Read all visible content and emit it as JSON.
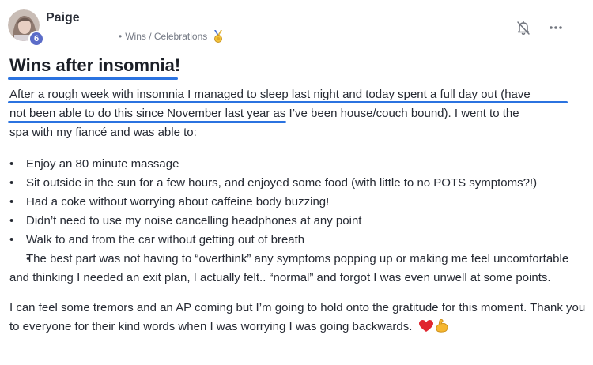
{
  "author": {
    "name": "Paige",
    "level": "6"
  },
  "meta": {
    "separator": "•",
    "category": "Wins / Celebrations"
  },
  "post": {
    "title": "Wins after insomnia!",
    "intro_line1": "After a rough week with insomnia I managed to sleep last night and today spent a full day out (have",
    "intro_line2_highlighted": "not been able to do this since November last year",
    "intro_line2_rest": " as I’ve been house/couch bound). I went to the",
    "intro_line3": "spa with my fiancé and was able to:",
    "bullets": [
      "Enjoy an 80 minute massage",
      "Sit outside in the sun for a few hours, and enjoyed some food (with little to no POTS symptoms?!)",
      "Had a coke without worrying about caffeine body buzzing!",
      "Didn’t need to use my noise cancelling headphones at any point",
      "Walk to and from the car without getting out of breath",
      "The best part was not having to “overthink” any symptoms popping up or making me feel uncomfortable and thinking I needed an exit plan, I actually felt.. “normal” and forgot I was even unwell at some points."
    ],
    "closing": "I can feel some tremors and an AP coming but I’m going to hold onto the gratitude for this moment. Thank you to everyone for their kind words when I was worrying I was going backwards."
  },
  "icons": {
    "notification": "bell-off-icon",
    "more": "more-horizontal-icon",
    "category_badge": "medal-icon",
    "emoji_1": "red-heart-icon",
    "emoji_2": "flexed-biceps-icon"
  },
  "colors": {
    "highlight": "#2b73e0",
    "badge": "#5b6cc8"
  }
}
